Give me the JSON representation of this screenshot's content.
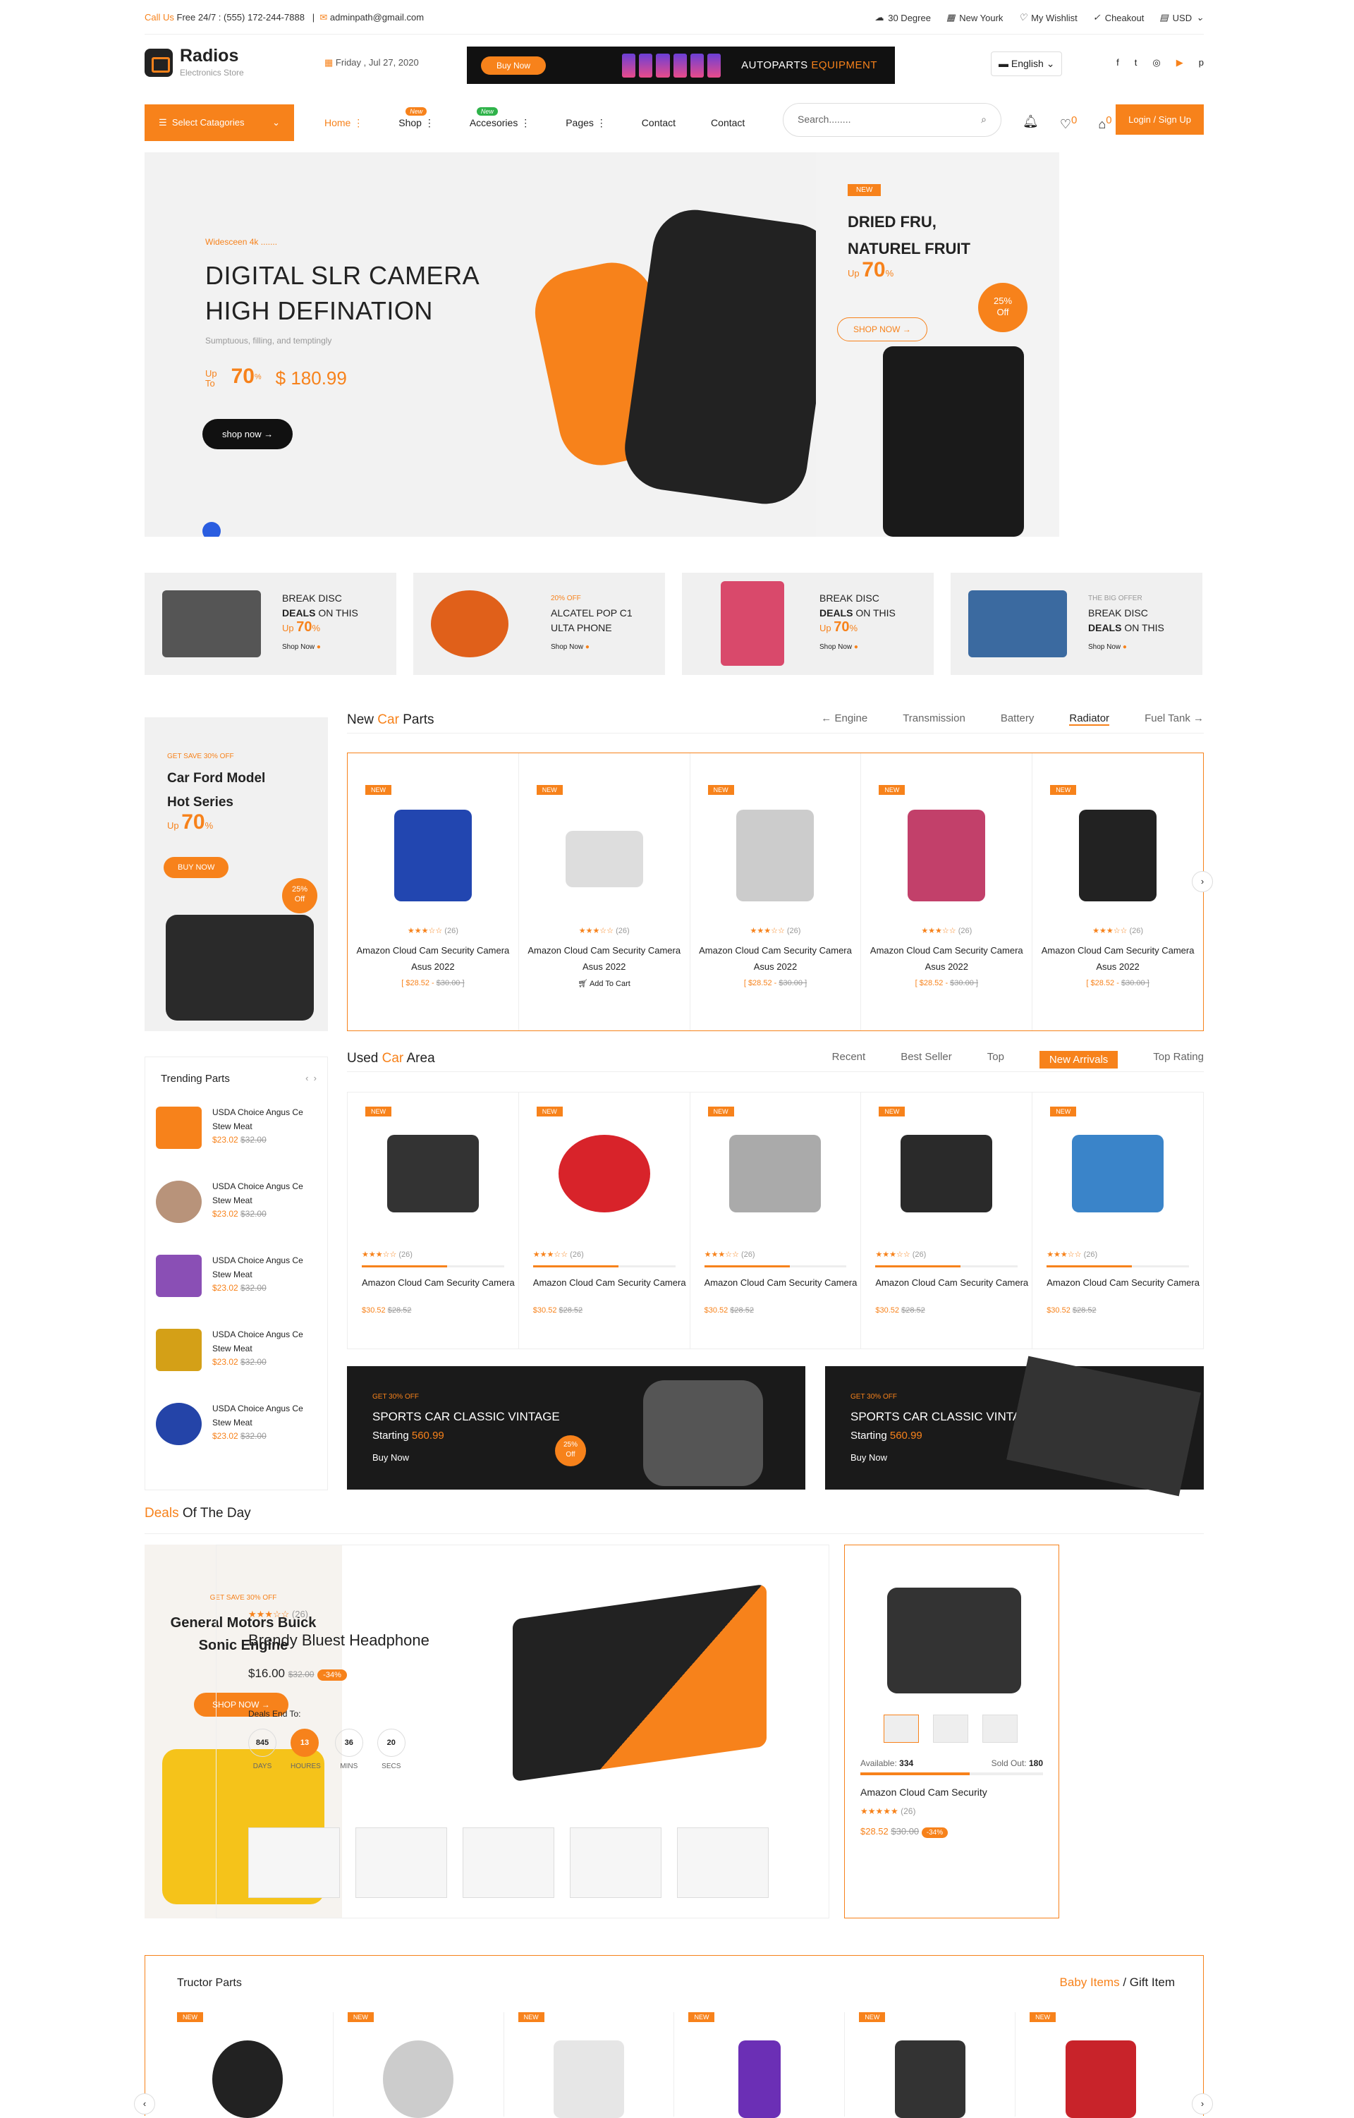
{
  "topbar": {
    "call_label": "Call Us",
    "call_text": "Free 24/7 : (555) 172-244-7888",
    "email": "adminpath@gmail.com",
    "weather": "30 Degree",
    "city": "New Yourk",
    "wishlist": "My Wishlist",
    "checkout": "Cheakout",
    "currency": "USD"
  },
  "header": {
    "brand": "Radios",
    "tagline": "Electronics Store",
    "date": "Friday , Jul 27, 2020",
    "promo_btn": "Buy Now",
    "promo_text_a": "AUTOPARTS",
    "promo_text_b": "EQUIPMENT",
    "lang": "English"
  },
  "nav": {
    "categories": "Select Catagories",
    "items": [
      "Home",
      "Shop",
      "Accesories",
      "Pages",
      "Contact",
      "Contact"
    ],
    "badge_new": "New",
    "search_placeholder": "Search........",
    "cart_count": "0",
    "wish_count": "0",
    "login": "Login / Sign Up"
  },
  "hero": {
    "sub": "Widesceen 4k .......",
    "title1": "DIGITAL SLR CAMERA",
    "title2": "HIGH DEFINATION",
    "desc": "Sumptuous, filling, and temptingly",
    "up": "Up",
    "to": "To",
    "pct": "70",
    "pct_sym": "%",
    "price": "$ 180.99",
    "btn": "shop now"
  },
  "side": {
    "new": "NEW",
    "title1": "DRIED FRU,",
    "title2": "NATUREL FRUIT",
    "pct": "70",
    "off_pct": "25%",
    "off": "Off",
    "btn": "SHOP NOW"
  },
  "banners": [
    {
      "l1": "BREAK DISC",
      "l2a": "DEALS",
      "l2b": "ON THIS",
      "pct": "70",
      "shop": "Shop Now"
    },
    {
      "small": "20% OFF",
      "l1": "ALCATEL POP C1",
      "l2": "ULTA PHONE",
      "shop": "Shop Now"
    },
    {
      "l1": "BREAK DISC",
      "l2a": "DEALS",
      "l2b": "ON THIS",
      "pct": "70",
      "shop": "Shop Now"
    },
    {
      "grey": "THE BIG OFFER",
      "l1": "BREAK DISC",
      "l2a": "DEALS",
      "l2b": "ON THIS",
      "shop": "Shop Now"
    }
  ],
  "leftcard": {
    "small": "GET SAVE 30% OFF",
    "title1": "Car Ford Model",
    "title2": "Hot Series",
    "pct": "70",
    "btn": "BUY NOW",
    "off_pct": "25%",
    "off": "Off"
  },
  "new_parts": {
    "title_a": "New",
    "title_b": "Car",
    "title_c": "Parts",
    "tabs": [
      "Engine",
      "Transmission",
      "Battery",
      "Radiator",
      "Fuel Tank"
    ],
    "new": "NEW",
    "rating": "(26)",
    "name": "Amazon Cloud Cam Security Camera Asus 2022",
    "price": "[ $28.52 -",
    "old": "$30.00 ]",
    "add": "Add To Cart"
  },
  "trending": {
    "title": "Trending Parts",
    "name": "USDA Choice Angus Ce Stew Meat",
    "price": "$23.02",
    "old": "$32.00"
  },
  "used": {
    "title_a": "Used",
    "title_b": "Car",
    "title_c": "Area",
    "tabs": [
      "Recent",
      "Best Seller",
      "Top",
      "New Arrivals",
      "Top Rating"
    ],
    "name": "Amazon Cloud Cam Security Camera",
    "price": "$30.52",
    "old": "$28.52"
  },
  "dark1": {
    "small": "GET 30% OFF",
    "title": "SPORTS CAR CLASSIC VINTAGE",
    "starting": "Starting",
    "price": "560.99",
    "btn": "Buy Now",
    "off_pct": "25%",
    "off": "Off"
  },
  "dark2": {
    "small": "GET 30% OFF",
    "title": "SPORTS CAR CLASSIC VINTAGE",
    "starting": "Starting",
    "price": "560.99",
    "btn": "Buy Now"
  },
  "deals": {
    "title_a": "Deals",
    "title_b": "Of The Day",
    "left_small": "GET SAVE 30% OFF",
    "left_t1": "General Motors Buick",
    "left_t2": "Sonic Engine",
    "left_btn": "SHOP NOW",
    "rating": "(26)",
    "name": "Brendy Bluest Headphone",
    "price": "$16.00",
    "old": "$32.00",
    "disc": "-34%",
    "end": "Deals End To:",
    "days": "845",
    "hours": "13",
    "mins": "36",
    "secs": "20",
    "days_l": "DAYS",
    "hours_l": "HOURES",
    "mins_l": "MINS",
    "secs_l": "SECS",
    "avail_l": "Available:",
    "avail": "334",
    "sold_l": "Sold Out:",
    "sold": "180",
    "r_name": "Amazon Cloud Cam Security",
    "r_price": "$28.52",
    "r_old": "$30.00"
  },
  "tructor": {
    "title": "Tructor Parts",
    "tab_a": "Baby Items",
    "tab_b": "/ Gift Item",
    "new": "NEW"
  }
}
